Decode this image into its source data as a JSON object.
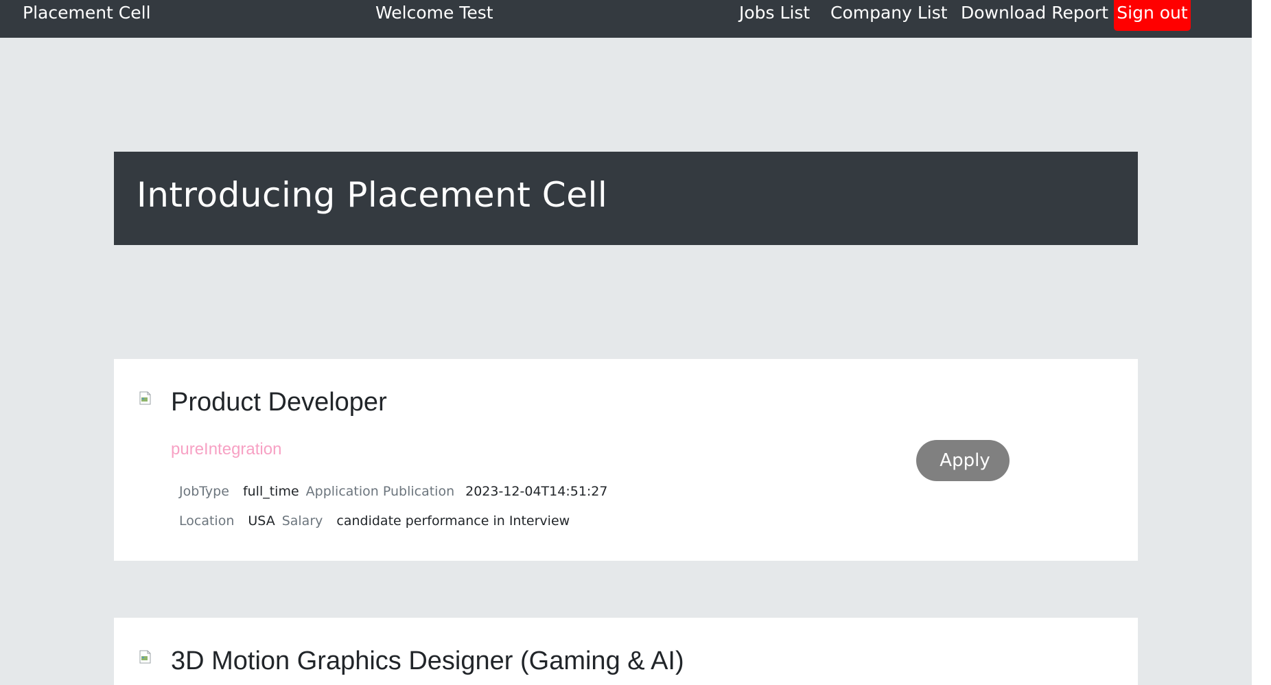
{
  "navbar": {
    "brand": "Placement Cell",
    "welcome": "Welcome Test",
    "links": {
      "jobs": "Jobs List",
      "companies": "Company List",
      "report": "Download Report"
    },
    "signout": "Sign out"
  },
  "hero": {
    "title": "Introducing Placement Cell"
  },
  "jobs": [
    {
      "title": "Product Developer",
      "company": "pureIntegration",
      "job_type_label": "JobType",
      "job_type": "full_time",
      "publication_label": "Application Publication",
      "publication": "2023-12-04T14:51:27",
      "location_label": "Location",
      "location": "USA",
      "salary_label": "Salary",
      "salary": "candidate performance in Interview",
      "apply_label": "Apply"
    },
    {
      "title": "3D Motion Graphics Designer (Gaming & AI)"
    }
  ],
  "colors": {
    "navbar_bg": "#343a40",
    "page_bg": "#e5e8ea",
    "signout_bg": "#ff0000",
    "company_link": "#f7a1c4",
    "apply_bg": "#808080"
  },
  "icons": {
    "job_logo": "broken-image-icon"
  }
}
